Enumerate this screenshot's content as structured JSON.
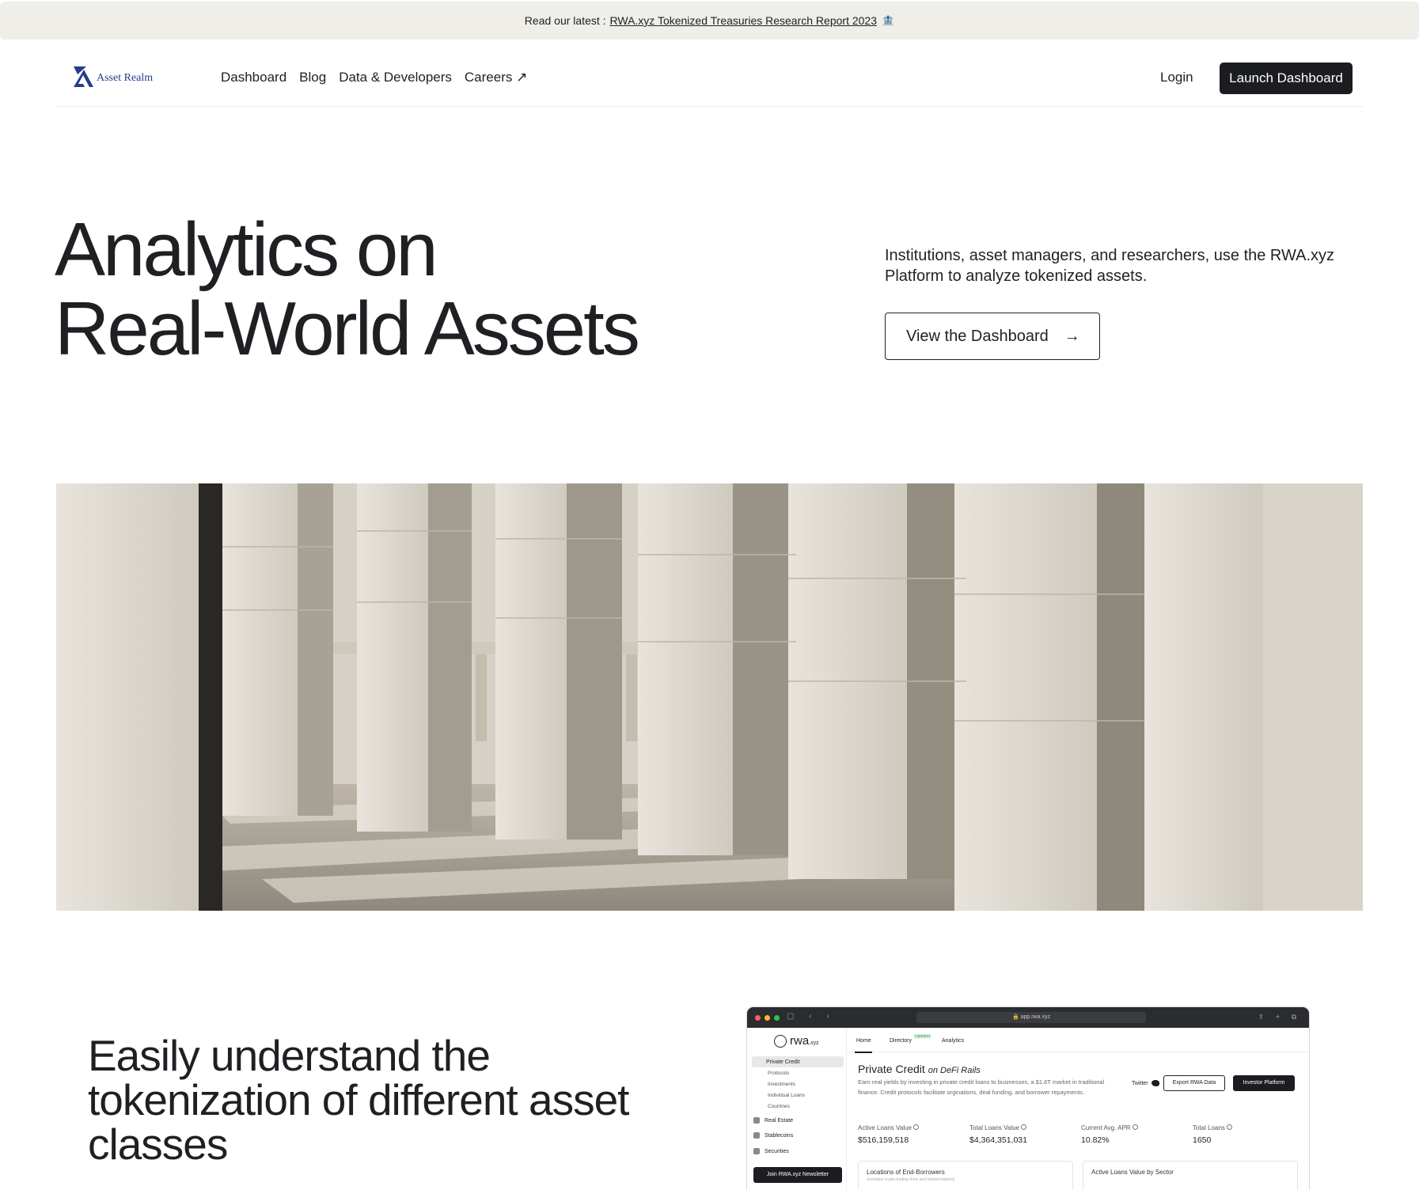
{
  "announcement": {
    "prefix": "Read our latest :",
    "link_text": "RWA.xyz Tokenized Treasuries Research Report 2023",
    "emoji": "🏦"
  },
  "nav": {
    "brand": "Asset Realm",
    "links": [
      "Dashboard",
      "Blog",
      "Data & Developers",
      "Careers ↗"
    ],
    "login": "Login",
    "cta": "Launch Dashboard"
  },
  "hero": {
    "title_line1": "Analytics on",
    "title_line2": "Real-World Assets",
    "description": "Institutions, asset managers, and researchers, use the RWA.xyz Platform to analyze tokenized assets.",
    "button": "View the Dashboard",
    "button_icon": "→"
  },
  "section2": {
    "title": "Easily understand the tokenization of different asset classes"
  },
  "mockup": {
    "url": "🔒 app.rwa.xyz",
    "brand": "rwa",
    "brand_suffix": ".xyz",
    "sidebar": {
      "active": "Private Credit",
      "sub_items": [
        "Protocols",
        "Investments",
        "Individual Loans",
        "Countries"
      ],
      "items": [
        "Real Estate",
        "Stablecoins",
        "Securities"
      ],
      "newsletter": "Join RWA.xyz Newsletter"
    },
    "tabs": [
      "Home",
      "Directory",
      "Analytics"
    ],
    "updated_badge": "Updated",
    "page_title": "Private Credit",
    "page_title_suffix": "on DeFi Rails",
    "page_desc": "Earn real yields by investing in private credit loans to businesses, a $1.6T market in traditional finance. Credit protocols facilitate orginations, deal funding, and borrower repayments.",
    "twitter": "Twitter",
    "export_btn": "Export RWA Data",
    "investor_btn": "Investor Platform",
    "stats": [
      {
        "label": "Active Loans Value",
        "value": "$516,159,518"
      },
      {
        "label": "Total Loans Value",
        "value": "$4,364,351,031"
      },
      {
        "label": "Current Avg. APR",
        "value": "10.82%"
      },
      {
        "label": "Total Loans",
        "value": "1650"
      }
    ],
    "card1_title": "Locations of End-Borrowers",
    "card1_sub": "(excludes crypto trading firms and market-makers)",
    "card2_title": "Active Loans Value by Sector"
  },
  "colors": {
    "announce_bg": "#efeee9",
    "dark": "#1c1d20",
    "brand_blue": "#253c8a"
  }
}
